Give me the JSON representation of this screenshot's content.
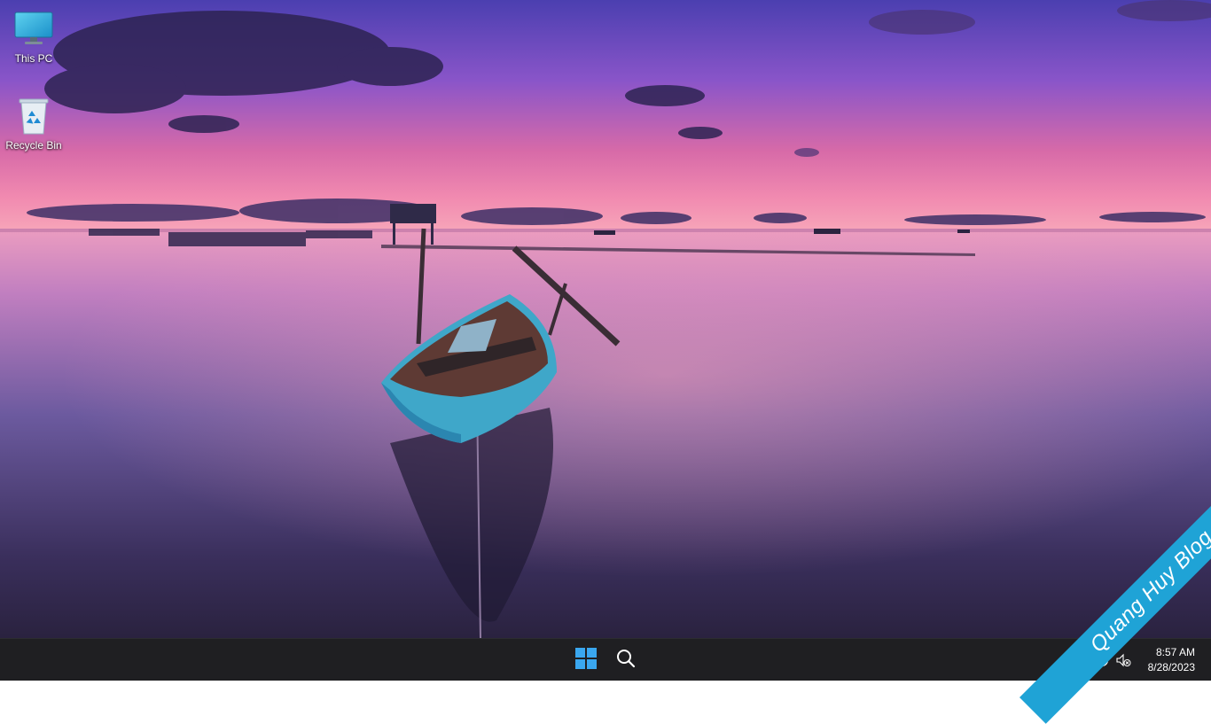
{
  "desktop": {
    "icons": [
      {
        "label": "This PC",
        "icon": "monitor-icon"
      },
      {
        "label": "Recycle Bin",
        "icon": "recycle-bin-icon"
      }
    ]
  },
  "taskbar": {
    "start_icon": "windows-start-icon",
    "search_icon": "search-icon",
    "tray": {
      "network_icon": "network-globe-icon",
      "volume_icon": "volume-muted-icon",
      "time": "8:57 AM",
      "date": "8/28/2023"
    }
  },
  "watermark": {
    "text": "Quang Huy Blog",
    "color": "#1fa3d6"
  },
  "colors": {
    "taskbar_bg": "#1f1f22",
    "start_blue": "#3aa7f0"
  }
}
